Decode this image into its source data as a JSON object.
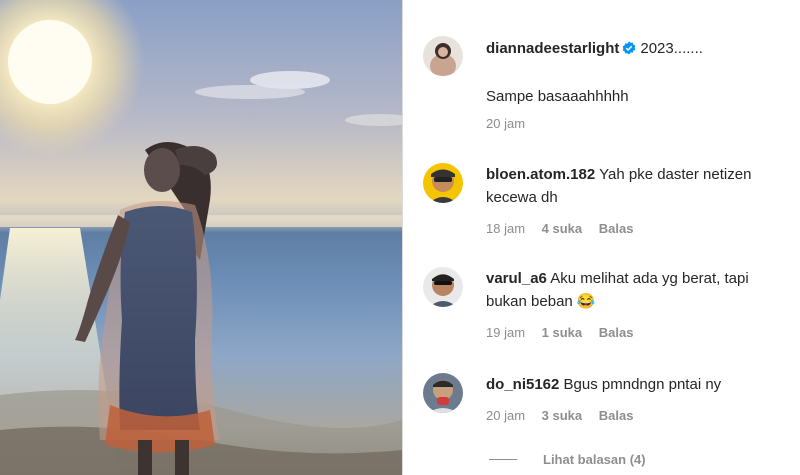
{
  "post": {
    "author": "diannadeestarlight",
    "verified": true,
    "caption_line1": "2023.......",
    "caption_line2": "Sampe basaaahhhhh",
    "time": "20 jam"
  },
  "comments": [
    {
      "username": "bloen.atom.182",
      "text": "Yah pke daster netizen kecewa dh",
      "time": "18 jam",
      "likes": "4 suka",
      "reply_label": "Balas"
    },
    {
      "username": "varul_a6",
      "text": "Aku melihat ada yg berat, tapi bukan beban 😂",
      "time": "19 jam",
      "likes": "1 suka",
      "reply_label": "Balas"
    },
    {
      "username": "do_ni5162",
      "text": "Bgus pmndngn pntai ny",
      "time": "20 jam",
      "likes": "3 suka",
      "reply_label": "Balas"
    }
  ],
  "view_replies": "Lihat balasan (4)",
  "colors": {
    "text": "#262626",
    "muted": "#8e8e8e",
    "verified": "#0095f6"
  },
  "icons": [
    "verified-badge-icon",
    "heart-icon"
  ]
}
